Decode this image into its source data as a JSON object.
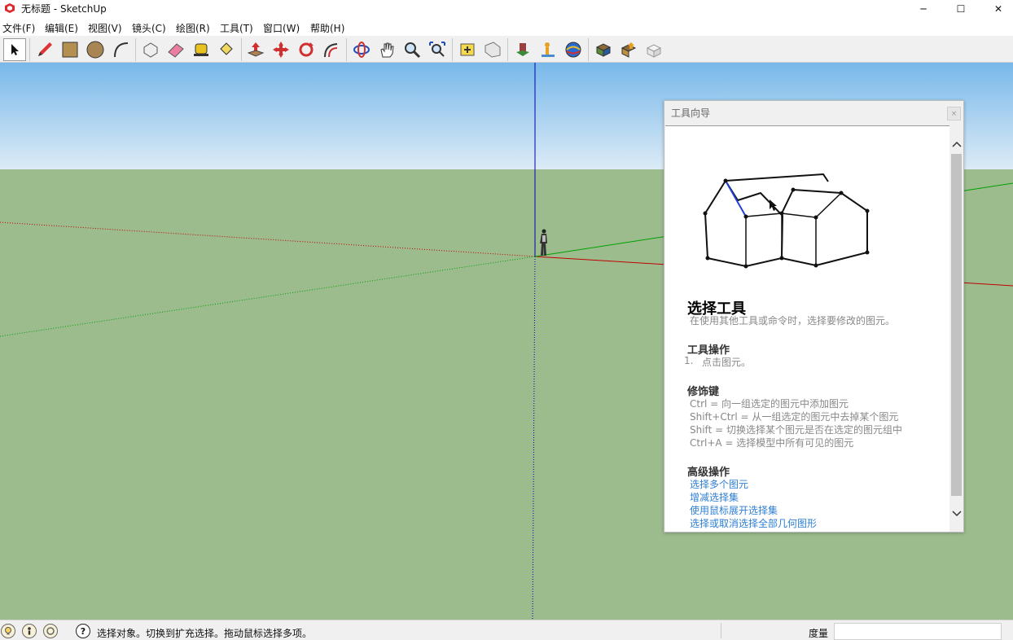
{
  "window": {
    "title": "无标题 - SketchUp",
    "controls": {
      "minimize": "─",
      "maximize": "☐",
      "close": "✕"
    }
  },
  "menu": [
    {
      "label": "文件(F)"
    },
    {
      "label": "编辑(E)"
    },
    {
      "label": "视图(V)"
    },
    {
      "label": "镜头(C)"
    },
    {
      "label": "绘图(R)"
    },
    {
      "label": "工具(T)"
    },
    {
      "label": "窗口(W)"
    },
    {
      "label": "帮助(H)"
    }
  ],
  "toolbar": {
    "tools": [
      "select-tool",
      "pencil-tool",
      "rectangle-tool",
      "circle-tool",
      "arc-tool",
      "make-component-tool",
      "eraser-tool",
      "tape-measure-tool",
      "paint-bucket-tool",
      "push-pull-tool",
      "move-tool",
      "rotate-tool",
      "offset-tool",
      "orbit-tool",
      "pan-tool",
      "zoom-tool",
      "zoom-extents-tool",
      "add-location-tool",
      "terrain-tool",
      "get-models-tool",
      "share-model-tool",
      "photo-textures-tool",
      "extension-warehouse-tool",
      "share-component-tool",
      "preview-tool"
    ]
  },
  "colors": {
    "sky_top": "#78b8ea",
    "sky_bottom": "#dcebf6",
    "ground": "#9cbc8e",
    "axis_red": "#c00000",
    "axis_green": "#00a000",
    "axis_blue": "#0000b0",
    "link": "#2e7fd3",
    "highlight_edge": "#2340d8"
  },
  "instructor": {
    "title": "工具向导",
    "close_glyph": "×",
    "tool_name": "选择工具",
    "tool_desc": "在使用其他工具或命令时，选择要修改的图元。",
    "operation_heading": "工具操作",
    "operation_steps": [
      {
        "num": "1.",
        "text": "点击图元。"
      }
    ],
    "modifier_heading": "修饰键",
    "modifiers": [
      "Ctrl = 向一组选定的图元中添加图元",
      "Shift+Ctrl = 从一组选定的图元中去掉某个图元",
      "Shift = 切换选择某个图元是否在选定的图元组中",
      "Ctrl+A = 选择模型中所有可见的图元"
    ],
    "advanced_heading": "高级操作",
    "advanced_links": [
      "选择多个图元",
      "增减选择集",
      "使用鼠标展开选择集",
      "选择或取消选择全部几何图形"
    ]
  },
  "status": {
    "help_glyph": "?",
    "text": "选择对象。切换到扩充选择。拖动鼠标选择多项。",
    "measure_label": "度量",
    "measure_value": ""
  }
}
